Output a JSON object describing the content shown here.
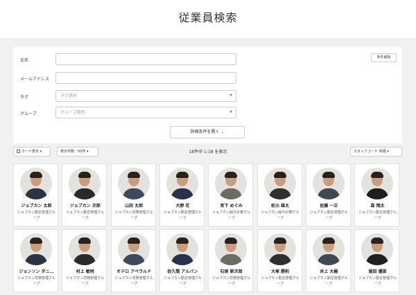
{
  "page_title": "従業員検索",
  "form": {
    "name_label": "氏名",
    "email_label": "メールアドレス",
    "tag_label": "タグ",
    "tag_placeholder": "タグ選択",
    "group_label": "グループ",
    "group_placeholder": "グループ選択",
    "clear_button": "条件解除",
    "detail_button": "詳細条件を開く"
  },
  "toolbar": {
    "view_mode": "カード表示",
    "per_page": "表示件数：50件",
    "result_count": "18件中 1-18 を表示",
    "sort": "スタッフコード 昇順"
  },
  "employees": [
    {
      "name": "ジョブカン 太郎",
      "dept": "ジョブカン勤怠管理グループ"
    },
    {
      "name": "ジョブカン 次郎",
      "dept": "ジョブカン勤怠管理グループ"
    },
    {
      "name": "山田 太郎",
      "dept": "ジョブカン労務管理グループ"
    },
    {
      "name": "大野 花",
      "dept": "ジョブカン勤怠管理グループ"
    },
    {
      "name": "宮下 めぐみ",
      "dept": "ジョブカン給与計算グループ"
    },
    {
      "name": "松元 雄太",
      "dept": "ジョブカン給与計算グループ"
    },
    {
      "name": "佐藤 一正",
      "dept": "ジョブカン勤怠管理グループ"
    },
    {
      "name": "森 翔太",
      "dept": "ジョブカン勤怠管理グループ"
    },
    {
      "name": "ジョンソン ダニ…",
      "dept": "ジョブカン労務管理グループ"
    },
    {
      "name": "村上 敏明",
      "dept": "ジョブカン労務管理グループ"
    },
    {
      "name": "オテロ アベラルド",
      "dept": "ジョブカン労務管理グループ"
    },
    {
      "name": "佐久間 アルバン",
      "dept": "ジョブカン勤怠管理グループ"
    },
    {
      "name": "石原 新次郎",
      "dept": "ジョブカン労務管理グループ"
    },
    {
      "name": "大塚 勝則",
      "dept": "ジョブカン勤怠管理グループ"
    },
    {
      "name": "井上 大樹",
      "dept": "ジョブカン勤怠管理グループ"
    },
    {
      "name": "堀田 優菜",
      "dept": "ジョブカン勤怠管理グループ"
    }
  ]
}
